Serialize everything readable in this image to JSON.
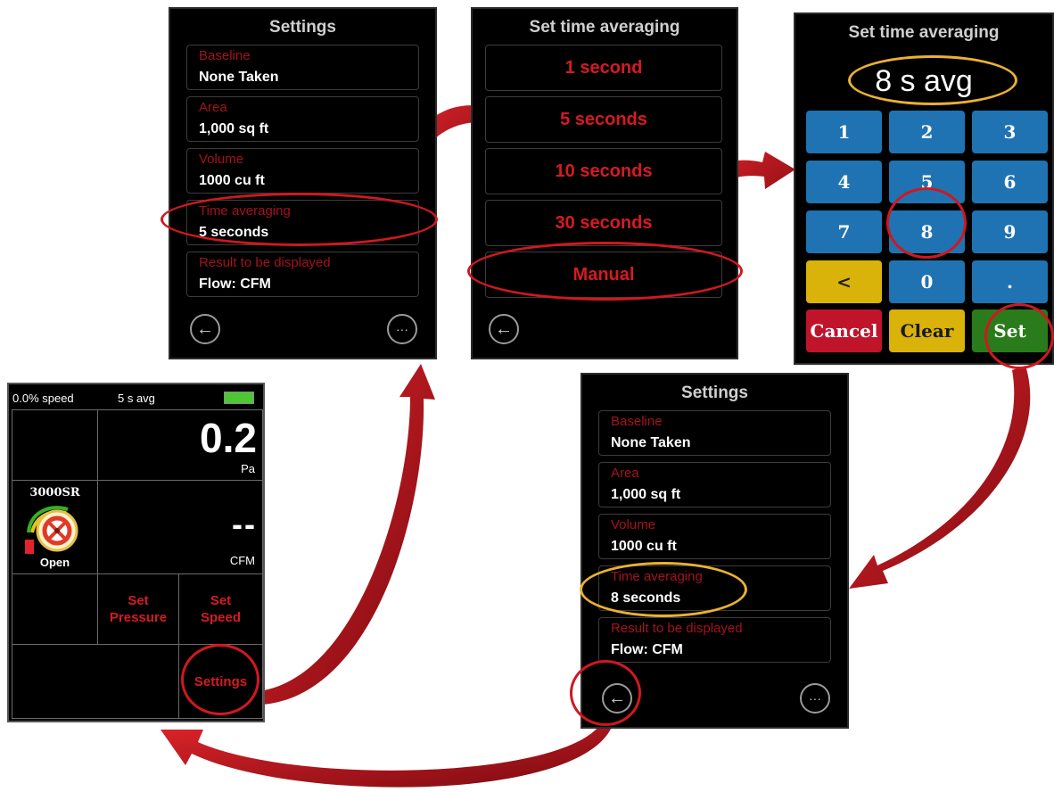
{
  "settings_screen": {
    "title": "Settings",
    "fields": [
      {
        "label": "Baseline",
        "value": "None Taken"
      },
      {
        "label": "Area",
        "value": "1,000 sq ft"
      },
      {
        "label": "Volume",
        "value": "1000 cu ft"
      },
      {
        "label": "Time averaging",
        "value": "5 seconds"
      },
      {
        "label": "Result to be displayed",
        "value": "Flow: CFM"
      }
    ],
    "back_icon": "arrow-left-icon",
    "more_icon": "ellipsis-icon",
    "more_glyph": "···",
    "back_glyph": "←"
  },
  "averaging_screen": {
    "title": "Set time averaging",
    "options": [
      "1 second",
      "5 seconds",
      "10 seconds",
      "30 seconds",
      "Manual"
    ],
    "back_glyph": "←"
  },
  "keypad_screen": {
    "title": "Set time averaging",
    "display": "8 s avg",
    "keys": [
      "1",
      "2",
      "3",
      "4",
      "5",
      "6",
      "7",
      "8",
      "9",
      "<",
      "0",
      "."
    ],
    "cancel_label": "Cancel",
    "clear_label": "Clear",
    "set_label": "Set"
  },
  "settings_screen_updated": {
    "title": "Settings",
    "fields": [
      {
        "label": "Baseline",
        "value": "None Taken"
      },
      {
        "label": "Area",
        "value": "1,000 sq ft"
      },
      {
        "label": "Volume",
        "value": "1000 cu ft"
      },
      {
        "label": "Time averaging",
        "value": "8 seconds"
      },
      {
        "label": "Result to be displayed",
        "value": "Flow: CFM"
      }
    ],
    "back_glyph": "←",
    "more_glyph": "···"
  },
  "main_screen": {
    "speed": "0.0% speed",
    "avg": "5 s avg",
    "pressure_value": "0.2",
    "pressure_unit": "Pa",
    "fan_model": "3000SR",
    "fan_state": "Open",
    "flow_value": "--",
    "flow_unit": "CFM",
    "set_pressure_label": "Set\nPressure",
    "set_speed_label": "Set\nSpeed",
    "settings_label": "Settings"
  },
  "colors": {
    "label_red": "#a4121e",
    "option_red": "#d41b23",
    "highlight_red": "#d01820",
    "highlight_yellow": "#eab133",
    "key_blue": "#1f73b2",
    "key_yellow": "#d9b20a",
    "key_red": "#c0142b",
    "key_green": "#2a7b1b",
    "battery_green": "#4cc830"
  }
}
